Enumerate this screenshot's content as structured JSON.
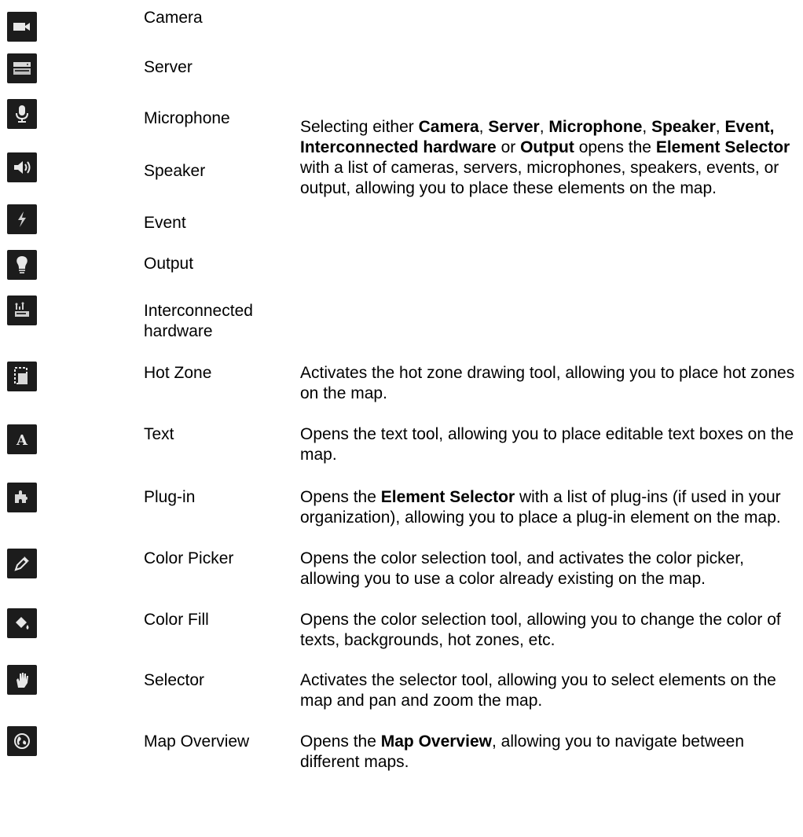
{
  "rows": [
    {
      "icon": "camera-icon",
      "label": "Camera"
    },
    {
      "icon": "server-icon",
      "label": "Server"
    },
    {
      "icon": "microphone-icon",
      "label": "Microphone"
    },
    {
      "icon": "speaker-icon",
      "label": "Speaker"
    },
    {
      "icon": "event-icon",
      "label": "Event"
    },
    {
      "icon": "output-icon",
      "label": "Output"
    },
    {
      "icon": "interconnected-hardware-icon",
      "label_line1": "Interconnected",
      "label_line2": "hardware"
    },
    {
      "icon": "hot-zone-icon",
      "label": "Hot Zone"
    },
    {
      "icon": "text-tool-icon",
      "label": "Text"
    },
    {
      "icon": "plug-in-icon",
      "label": "Plug-in"
    },
    {
      "icon": "color-picker-icon",
      "label": "Color Picker"
    },
    {
      "icon": "color-fill-icon",
      "label": "Color Fill"
    },
    {
      "icon": "selector-icon",
      "label": "Selector"
    },
    {
      "icon": "map-overview-icon",
      "label": "Map Overview"
    }
  ],
  "group_desc": {
    "t1": "Selecting either ",
    "b1": "Camera",
    "t2": ", ",
    "b2": "Server",
    "t3": ", ",
    "b3": "Microphone",
    "t4": ", ",
    "b4": "Speaker",
    "t5": ", ",
    "b5": "Event, Interconnected hardware",
    "t6": " or ",
    "b6": "Output",
    "t7": " opens the ",
    "b7": "Element Selector",
    "t8": " with a list of cameras, servers, microphones, speakers, events, or output, allowing you to place these elements on the map."
  },
  "desc": {
    "hot_zone": "Activates the hot zone drawing tool, allowing you to place hot zones on the map.",
    "text": "Opens the text tool, allowing you to place editable text boxes on the map.",
    "plugin_t1": "Opens the ",
    "plugin_b1": "Element Selector",
    "plugin_t2": " with a list of plug-ins (if used in your organization), allowing you to place a plug-in element on the map.",
    "color_picker": "Opens the color selection tool, and activates the color picker, allowing you to use a color already existing on the map.",
    "color_fill": "Opens the color selection tool, allowing you to change the color of texts, backgrounds, hot zones, etc.",
    "selector": "Activates the selector tool, allowing you to select elements on the map and pan and zoom the map.",
    "map_t1": "Opens the ",
    "map_b1": "Map Overview",
    "map_t2": ", allowing you to navigate between different maps."
  }
}
